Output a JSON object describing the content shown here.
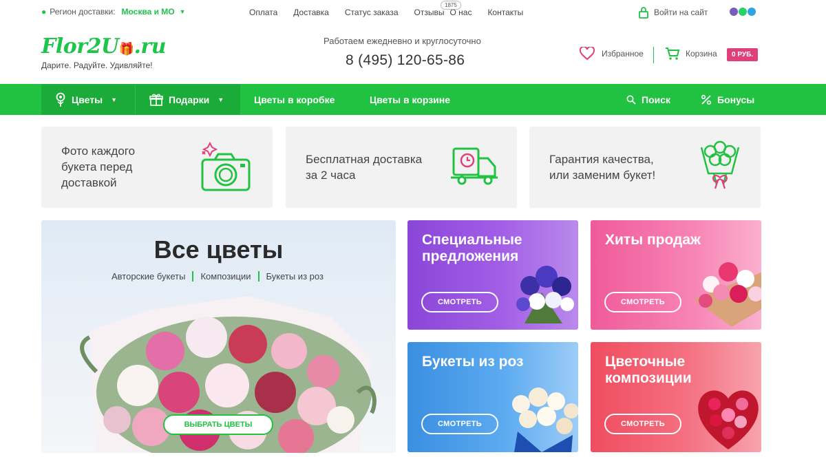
{
  "topbar": {
    "region_label": "Регион доставки:",
    "region_city": "Москва и МО",
    "links": [
      "Оплата",
      "Доставка",
      "Статус заказа",
      "Отзывы",
      "О нас",
      "Контакты"
    ],
    "reviews_badge": "1875",
    "login_label": "Войти на сайт"
  },
  "header": {
    "logo_main": "Flor2U",
    "logo_tld": ".ru",
    "tagline": "Дарите. Радуйте. Удивляйте!",
    "worktime": "Работаем ежедневно и круглосуточно",
    "phone": "8 (495) 120-65-86",
    "favorites_label": "Избранное",
    "cart_label": "Корзина",
    "cart_total": "0 РУБ."
  },
  "nav": {
    "flowers": "Цветы",
    "gifts": "Подарки",
    "box": "Цветы в коробке",
    "basket": "Цветы в корзине",
    "search": "Поиск",
    "bonus": "Бонусы"
  },
  "features": [
    {
      "text": "Фото каждого букета перед доставкой",
      "icon": "camera-icon"
    },
    {
      "text": "Бесплатная доставка за 2 часа",
      "icon": "truck-icon"
    },
    {
      "text": "Гарантия качества, или заменим букет!",
      "icon": "bouquet-icon"
    }
  ],
  "hero": {
    "title": "Все цветы",
    "links": [
      "Авторские букеты",
      "Композиции",
      "Букеты из роз"
    ],
    "button": "ВЫБРАТЬ ЦВЕТЫ"
  },
  "promos": [
    {
      "title": "Специальные предложения",
      "button": "СМОТРЕТЬ"
    },
    {
      "title": "Хиты продаж",
      "button": "СМОТРЕТЬ"
    },
    {
      "title": "Букеты из роз",
      "button": "СМОТРЕТЬ"
    },
    {
      "title": "Цветочные композиции",
      "button": "СМОТРЕТЬ"
    }
  ],
  "colors": {
    "brand_green": "#21c142",
    "brand_pink": "#e0407a"
  }
}
